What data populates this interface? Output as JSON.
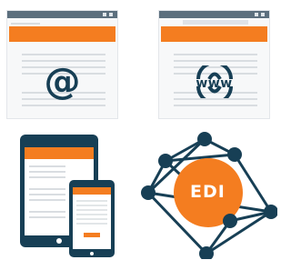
{
  "tiles": {
    "email": {
      "symbol": "@"
    },
    "web": {
      "symbol": "www"
    },
    "mobile": {},
    "edi": {
      "label": "EDI"
    }
  },
  "colors": {
    "navy": "#173f55",
    "orange": "#f47d20",
    "slate": "#5c6f7e",
    "line": "#d9dde1",
    "panel": "#f7f8f9"
  }
}
